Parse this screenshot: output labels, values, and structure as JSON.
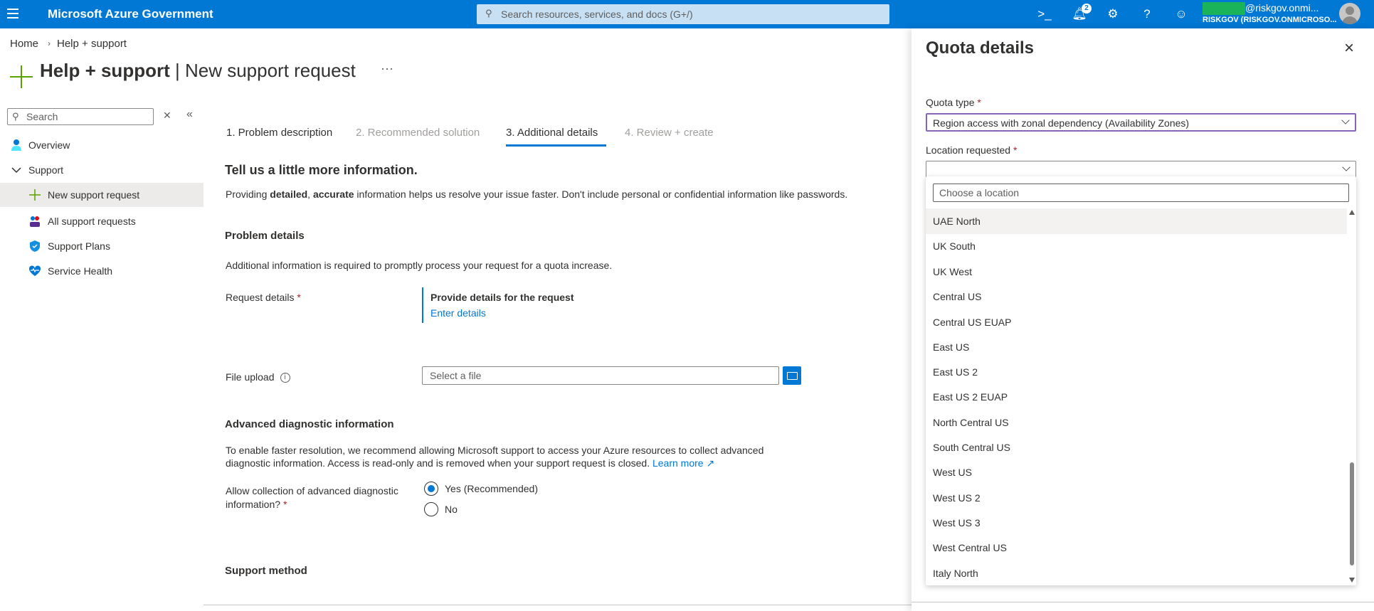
{
  "topbar": {
    "brand": "Microsoft Azure Government",
    "search_placeholder": "Search resources, services, and docs (G+/)",
    "notifications_count": "2",
    "user_email": "@riskgov.onmi...",
    "user_tenant": "RISKGOV (RISKGOV.ONMICROSO..."
  },
  "breadcrumb": {
    "home": "Home",
    "current": "Help + support"
  },
  "page": {
    "title_bold": "Help + support",
    "title_sep": " | ",
    "title_rest": "New support request",
    "more": "···"
  },
  "sidebar": {
    "search_placeholder": "Search",
    "items": [
      {
        "label": "Overview"
      },
      {
        "label": "Support"
      },
      {
        "label": "New support request"
      },
      {
        "label": "All support requests"
      },
      {
        "label": "Support Plans"
      },
      {
        "label": "Service Health"
      }
    ]
  },
  "steps": [
    {
      "label": "1. Problem description",
      "state": "done"
    },
    {
      "label": "2. Recommended solution",
      "state": "disabled"
    },
    {
      "label": "3. Additional details",
      "state": "active"
    },
    {
      "label": "4. Review + create",
      "state": "disabled"
    }
  ],
  "form": {
    "heading": "Tell us a little more information.",
    "intro_a": "Providing ",
    "intro_b": "detailed",
    "intro_c": ", ",
    "intro_d": "accurate",
    "intro_e": " information helps us resolve your issue faster. Don't include personal or confidential information like passwords.",
    "problem_heading": "Problem details",
    "problem_text": "Additional information is required to promptly process your request for a quota increase.",
    "request_label": "Request details",
    "request_title": "Provide details for the request",
    "request_link": "Enter details",
    "file_label": "File upload",
    "file_placeholder": "Select a file",
    "adv_heading": "Advanced diagnostic information",
    "adv_text1": "To enable faster resolution, we recommend allowing Microsoft support to access your Azure resources to collect advanced",
    "adv_text2": "diagnostic information. Access is read-only and is removed when your support request is closed. ",
    "adv_link": "Learn more",
    "allow_label1": "Allow collection of advanced diagnostic",
    "allow_label2": "information?",
    "radio_yes": "Yes (Recommended)",
    "radio_no": "No",
    "radio_selected": "yes",
    "support_heading": "Support method"
  },
  "panel": {
    "title": "Quota details",
    "quota_type_label": "Quota type",
    "quota_type_value": "Region access with zonal dependency (Availability Zones)",
    "location_label": "Location requested",
    "location_value": "",
    "filter_placeholder": "Choose a location",
    "options": [
      "UAE North",
      "UK South",
      "UK West",
      "Central US",
      "Central US EUAP",
      "East US",
      "East US 2",
      "East US 2 EUAP",
      "North Central US",
      "South Central US",
      "West US",
      "West US 2",
      "West US 3",
      "West Central US",
      "Italy North"
    ],
    "highlighted": "UAE North"
  },
  "colors": {
    "brand": "#0078d4",
    "accent_green": "#57a300",
    "required": "#a4262c",
    "focus_border": "#8764b8"
  }
}
